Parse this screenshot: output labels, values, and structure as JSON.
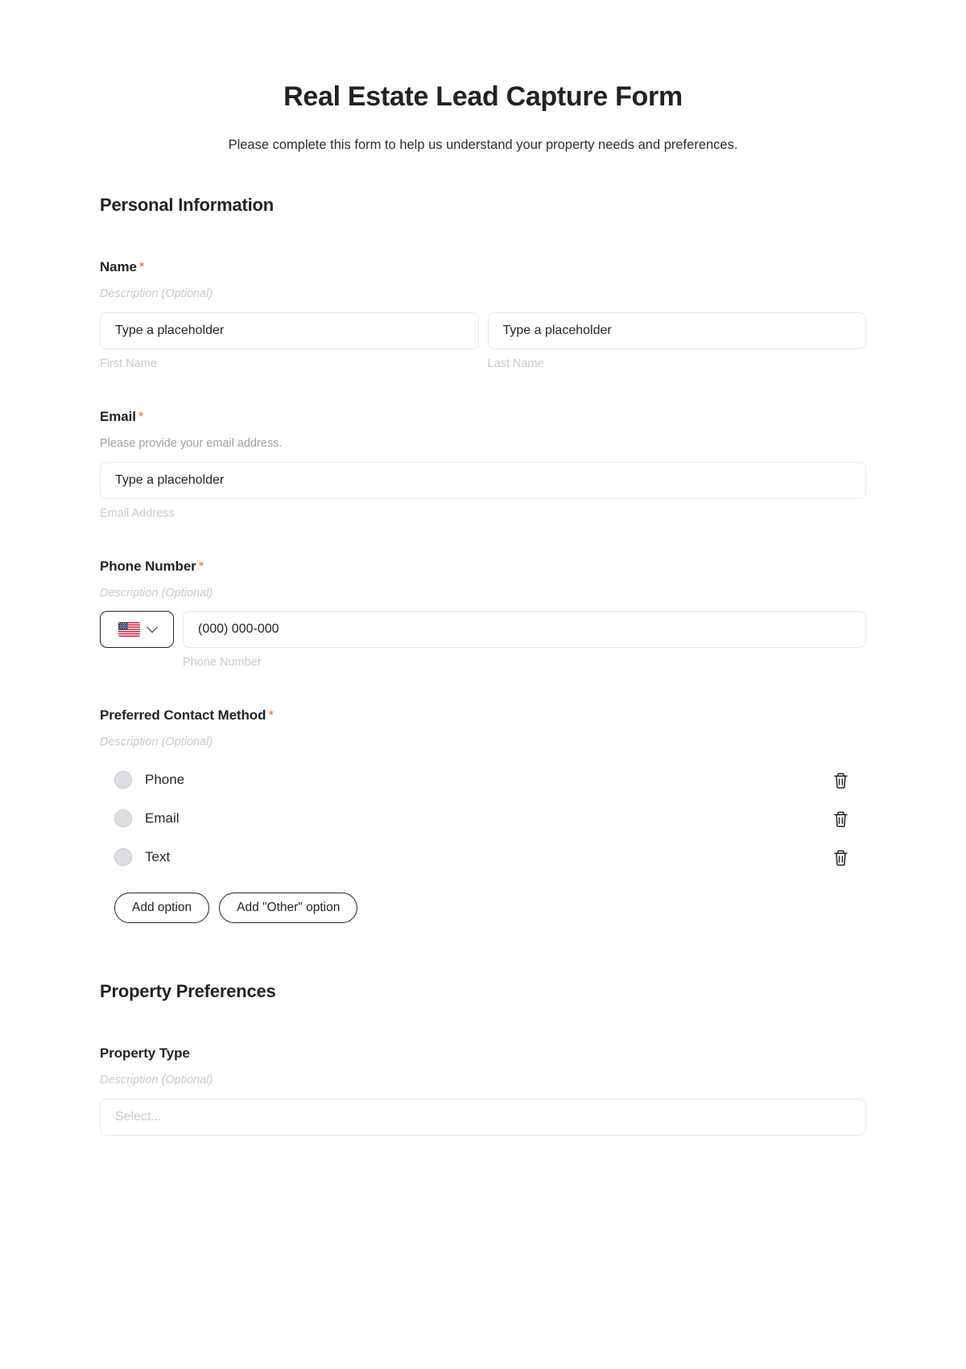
{
  "form": {
    "title": "Real Estate Lead Capture Form",
    "subtitle": "Please complete this form to help us understand your property needs and preferences."
  },
  "colors": {
    "required_asterisk": "#f2663c",
    "text_primary": "#1f2328",
    "placeholder_desc": "#c7cad3",
    "description": "#9aa0ad",
    "input_border": "#e6e8ec",
    "radio_fill": "#dcdee1",
    "button_border": "#22262c"
  },
  "sections": [
    {
      "heading": "Personal Information",
      "fields": [
        {
          "label": "Name",
          "required_mark": "*",
          "description": "Description (Optional)",
          "description_is_placeholder": true,
          "type": "name-split",
          "inputs": [
            {
              "placeholder": "Type a placeholder",
              "sublabel": "First Name"
            },
            {
              "placeholder": "Type a placeholder",
              "sublabel": "Last Name"
            }
          ]
        },
        {
          "label": "Email",
          "required_mark": "*",
          "description": "Please provide your email address.",
          "description_is_placeholder": false,
          "type": "email",
          "inputs": [
            {
              "placeholder": "Type a placeholder",
              "sublabel": "Email Address"
            }
          ]
        },
        {
          "label": "Phone Number",
          "required_mark": "*",
          "description": "Description (Optional)",
          "description_is_placeholder": true,
          "type": "phone",
          "country_flag": "us-flag-icon",
          "dropdown_icon": "chevron-down-icon",
          "inputs": [
            {
              "placeholder": "(000) 000-000",
              "sublabel": "Phone Number"
            }
          ]
        },
        {
          "label": "Preferred Contact Method",
          "required_mark": "*",
          "description": "Description (Optional)",
          "description_is_placeholder": true,
          "type": "radio",
          "options": [
            {
              "label": "Phone",
              "delete_icon": "trash-icon"
            },
            {
              "label": "Email",
              "delete_icon": "trash-icon"
            },
            {
              "label": "Text",
              "delete_icon": "trash-icon"
            }
          ],
          "add_option_label": "Add option",
          "add_other_label": "Add \"Other\" option"
        }
      ]
    },
    {
      "heading": "Property Preferences",
      "fields": [
        {
          "label": "Property Type",
          "required_mark": "",
          "description": "Description (Optional)",
          "description_is_placeholder": true,
          "type": "select",
          "select_placeholder": "Select..."
        }
      ]
    }
  ]
}
